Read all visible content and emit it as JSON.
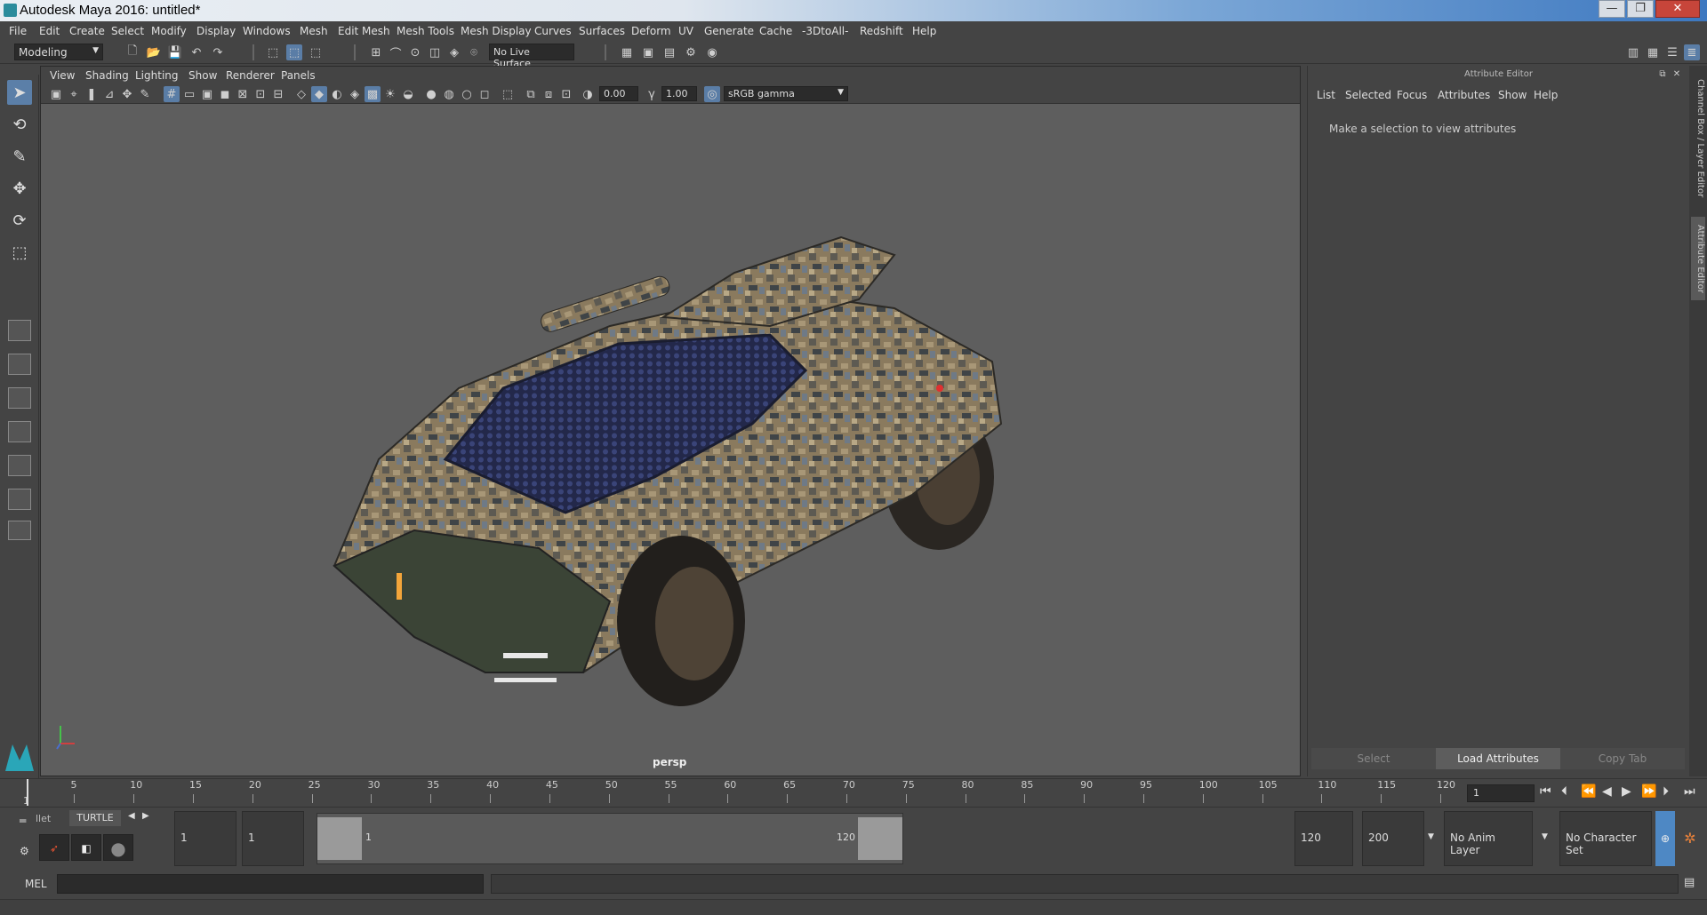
{
  "window": {
    "title": "Autodesk Maya 2016: untitled*"
  },
  "menubar": [
    "File",
    "Edit",
    "Create",
    "Select",
    "Modify",
    "Display",
    "Windows",
    "Mesh",
    "Edit Mesh",
    "Mesh Tools",
    "Mesh Display",
    "Curves",
    "Surfaces",
    "Deform",
    "UV",
    "Generate",
    "Cache",
    "-3DtoAll-",
    "Redshift",
    "Help"
  ],
  "statusline": {
    "menuset": "Modeling",
    "live_surface": "No Live Surface"
  },
  "viewport": {
    "menus": [
      "View",
      "Shading",
      "Lighting",
      "Show",
      "Renderer",
      "Panels"
    ],
    "exposure": "0.00",
    "gamma": "1.00",
    "colorspace": "sRGB gamma",
    "camera": "persp"
  },
  "attribute_editor": {
    "title": "Attribute Editor",
    "menus": [
      "List",
      "Selected",
      "Focus",
      "Attributes",
      "Show",
      "Help"
    ],
    "message": "Make a selection to view attributes",
    "buttons": {
      "select": "Select",
      "load": "Load Attributes",
      "copy": "Copy Tab"
    }
  },
  "side_tabs": {
    "channel_box": "Channel Box / Layer Editor",
    "attribute_editor": "Attribute Editor"
  },
  "timeline": {
    "tick_labels": [
      "1",
      "5",
      "10",
      "15",
      "20",
      "25",
      "30",
      "35",
      "40",
      "45",
      "50",
      "55",
      "60",
      "65",
      "70",
      "75",
      "80",
      "85",
      "90",
      "95",
      "100",
      "105",
      "110",
      "115",
      "120"
    ],
    "current_frame": "1"
  },
  "range": {
    "shelf_tabs": [
      "llet",
      "TURTLE"
    ],
    "start": "1",
    "anim_start": "1",
    "range_start_label": "1",
    "range_end_label": "120",
    "anim_end": "120",
    "end": "200",
    "anim_layer": "No Anim Layer",
    "character_set": "No Character Set"
  },
  "cmdline": {
    "label": "MEL"
  }
}
